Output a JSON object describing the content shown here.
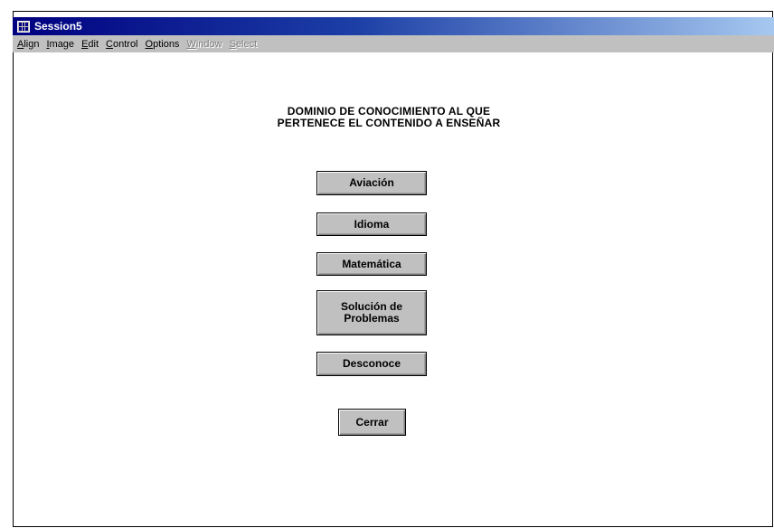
{
  "window": {
    "title": "Session5"
  },
  "menu": [
    {
      "label": "Align",
      "enabled": true
    },
    {
      "label": "Image",
      "enabled": true
    },
    {
      "label": "Edit",
      "enabled": true
    },
    {
      "label": "Control",
      "enabled": true
    },
    {
      "label": "Options",
      "enabled": true
    },
    {
      "label": "Window",
      "enabled": false
    },
    {
      "label": "Select",
      "enabled": false
    }
  ],
  "heading": {
    "line1": "DOMINIO DE CONOCIMIENTO AL QUE",
    "line2": "PERTENECE EL CONTENIDO A ENSEÑAR"
  },
  "buttons": {
    "aviacion": "Aviación",
    "idioma": "Idioma",
    "matematica": "Matemática",
    "solucion_line1": "Solución de",
    "solucion_line2": "Problemas",
    "desconoce": "Desconoce",
    "cerrar": "Cerrar"
  },
  "colors": {
    "titlebar_start": "#000080",
    "face": "#c0c0c0"
  }
}
